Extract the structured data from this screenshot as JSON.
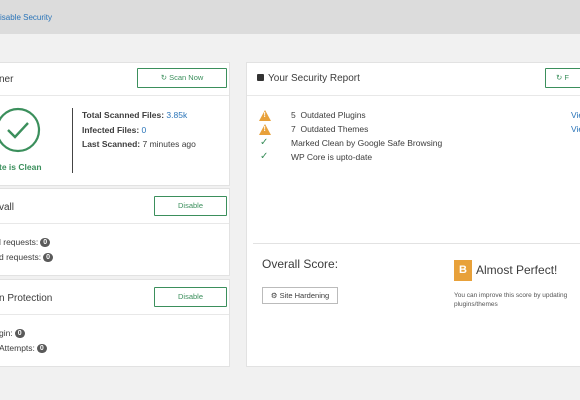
{
  "topbar": {
    "link": "isable Security"
  },
  "scanner": {
    "title": "ner",
    "scan_button": "Scan Now",
    "status": "te is Clean",
    "total_label": "Total Scanned Files:",
    "total_value": "3.85k",
    "infected_label": "Infected Files:",
    "infected_value": "0",
    "last_label": "Last Scanned:",
    "last_value": "7 minutes ago"
  },
  "firewall": {
    "title": "vall",
    "button": "Disable",
    "row1": "l requests:",
    "row1_count": "0",
    "row2": "d requests:",
    "row2_count": "0"
  },
  "login": {
    "title": "n Protection",
    "button": "Disable",
    "row1": "gin:",
    "row1_count": "0",
    "row2": "Attempts:",
    "row2_count": "0"
  },
  "report": {
    "title": "Your Security Report",
    "button_partial": "F",
    "items": [
      {
        "count": "5",
        "text": "Outdated Plugins",
        "link": "Vie"
      },
      {
        "count": "7",
        "text": "Outdated Themes",
        "link": "Vie"
      },
      {
        "text": "Marked Clean by Google Safe Browsing"
      },
      {
        "text": "WP Core is upto-date"
      }
    ]
  },
  "score": {
    "label": "Overall Score:",
    "grade": "B",
    "grade_text": "Almost Perfect!",
    "hardening_button": "Site Hardening",
    "hint": "You can improve this score by updating",
    "hint2": "plugins/themes"
  },
  "colors": {
    "accent_green": "#3b8f5c",
    "warning": "#e8a13a",
    "link": "#2a74b8"
  }
}
